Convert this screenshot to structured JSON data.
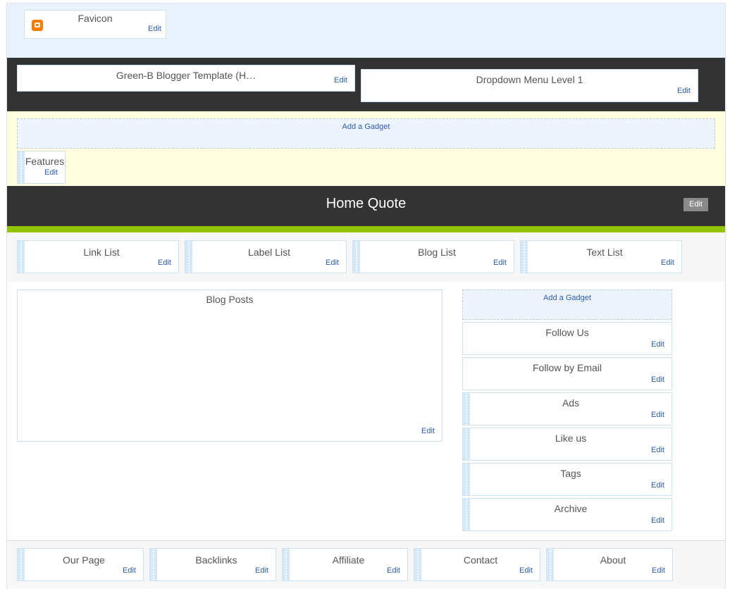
{
  "edit_label": "Edit",
  "header": {
    "favicon": {
      "title": "Favicon",
      "edit": "Edit"
    },
    "template_title": {
      "title": "Green-B Blogger Template (H…",
      "edit": "Edit"
    },
    "dropdown": {
      "title": "Dropdown Menu Level 1",
      "edit": "Edit"
    }
  },
  "features": {
    "add_gadget": "Add a Gadget",
    "widget": {
      "title": "Features",
      "edit": "Edit"
    }
  },
  "quote": {
    "title": "Home Quote",
    "edit": "Edit"
  },
  "lists": [
    {
      "title": "Link List",
      "edit": "Edit"
    },
    {
      "title": "Label List",
      "edit": "Edit"
    },
    {
      "title": "Blog List",
      "edit": "Edit"
    },
    {
      "title": "Text List",
      "edit": "Edit"
    }
  ],
  "main": {
    "title": "Blog Posts",
    "edit": "Edit"
  },
  "sidebar": {
    "add_gadget": "Add a Gadget",
    "items": [
      {
        "title": "Follow Us",
        "edit": "Edit"
      },
      {
        "title": "Follow by Email",
        "edit": "Edit"
      },
      {
        "title": "Ads",
        "edit": "Edit"
      },
      {
        "title": "Like us",
        "edit": "Edit"
      },
      {
        "title": "Tags",
        "edit": "Edit"
      },
      {
        "title": "Archive",
        "edit": "Edit"
      }
    ]
  },
  "footer": [
    {
      "title": "Our Page",
      "edit": "Edit"
    },
    {
      "title": "Backlinks",
      "edit": "Edit"
    },
    {
      "title": "Affiliate",
      "edit": "Edit"
    },
    {
      "title": "Contact",
      "edit": "Edit"
    },
    {
      "title": "About",
      "edit": "Edit"
    }
  ],
  "colors": {
    "dark_band": "#333333",
    "accent_green": "#93c400",
    "link_blue": "#2a5db0",
    "top_band": "#eaf2fd",
    "features_band": "#ffffe0"
  }
}
